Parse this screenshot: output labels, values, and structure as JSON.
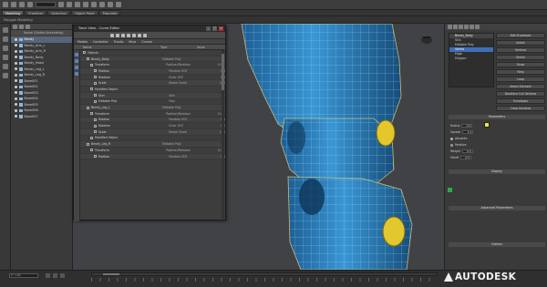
{
  "brand": {
    "name": "AUTODESK"
  },
  "colors": {
    "accent": "#3c6fb8",
    "mesh": "#2e7fbf",
    "wire": "#8fe0ff",
    "knob": "#e3c72d",
    "swatch": "#e8e83a"
  },
  "toolbar": {
    "icons": [
      "undo-icon",
      "redo-icon",
      "link-icon",
      "unlink-icon",
      "select-icon",
      "move-icon",
      "rotate-icon",
      "scale-icon",
      "snap-icon",
      "mirror-icon",
      "align-icon",
      "render-icon"
    ]
  },
  "tabs": [
    "Modeling",
    "Freeform",
    "Selection",
    "Object Paint",
    "Populate"
  ],
  "ribbon": {
    "label": "Polygon Modeling"
  },
  "viewport": {
    "label": "[+] [Perspective] [Realistic]"
  },
  "explorer": {
    "column": "Name (Sorted Ascending)",
    "items": [
      "Bendy",
      "Bendy_Arm_L",
      "Bendy_Arm_R",
      "Bendy_Body",
      "Bendy_Head",
      "Bendy_Leg_L",
      "Bendy_Leg_R",
      "Bone001",
      "Bone002",
      "Bone003",
      "Bone004",
      "Bone005",
      "Bone006",
      "Bone007"
    ],
    "selected": 0
  },
  "dialog": {
    "title": "Track View - Curve Editor",
    "menu": [
      "Modes",
      "Controller",
      "Tracks",
      "Keys",
      "Curves"
    ],
    "columns": [
      "Name",
      "Type",
      "Value"
    ],
    "rows": [
      {
        "name": "Objects",
        "type": "",
        "value": ""
      },
      {
        "name": "Bendy_Body",
        "type": "Editable Poly",
        "value": ""
      },
      {
        "name": "Transform",
        "type": "Position/Rotation",
        "value": "0.0"
      },
      {
        "name": "Position",
        "type": "Position XYZ",
        "value": "0.0"
      },
      {
        "name": "Rotation",
        "type": "Euler XYZ",
        "value": "0.0"
      },
      {
        "name": "Scale",
        "type": "Bezier Scale",
        "value": "100"
      },
      {
        "name": "Modified Object",
        "type": "",
        "value": ""
      },
      {
        "name": "Skin",
        "type": "Skin",
        "value": ""
      },
      {
        "name": "Editable Poly",
        "type": "Poly",
        "value": ""
      },
      {
        "name": "Bendy_Leg_L",
        "type": "Editable Poly",
        "value": ""
      },
      {
        "name": "Transform",
        "type": "Position/Rotation",
        "value": "0.0"
      },
      {
        "name": "Position",
        "type": "Position XYZ",
        "value": "0.0"
      },
      {
        "name": "Rotation",
        "type": "Euler XYZ",
        "value": "0.0"
      },
      {
        "name": "Scale",
        "type": "Bezier Scale",
        "value": "100"
      },
      {
        "name": "Modified Object",
        "type": "",
        "value": ""
      },
      {
        "name": "Bendy_Leg_R",
        "type": "Editable Poly",
        "value": ""
      },
      {
        "name": "Transform",
        "type": "Position/Rotation",
        "value": "0.0"
      },
      {
        "name": "Position",
        "type": "Position XYZ",
        "value": "0.0"
      }
    ]
  },
  "command": {
    "object_name": "Bendy_Body",
    "stack": [
      "Skin",
      "Editable Poly",
      "Vertex",
      "Edge",
      "Polygon"
    ],
    "stack_selected": 2,
    "buttons": [
      "Edit Envelopes",
      "Select",
      "Vertices",
      "Shrink",
      "Grow",
      "Ring",
      "Loop",
      "Select Element",
      "Backface Cull Vertices",
      "Envelopes",
      "Cross Sections"
    ],
    "rollouts": [
      "Parameters",
      "Display",
      "Advanced Parameters",
      "Gizmos"
    ],
    "props": [
      {
        "label": "Radius",
        "value": "0.0"
      },
      {
        "label": "Squash",
        "value": "1.0"
      },
      {
        "label": "Absolute",
        "value": ""
      },
      {
        "label": "Relative",
        "value": ""
      },
      {
        "label": "Weight",
        "value": "0.0"
      },
      {
        "label": "Falloff",
        "value": "0.5"
      }
    ]
  },
  "timeline": {
    "frame": "0 / 100"
  }
}
